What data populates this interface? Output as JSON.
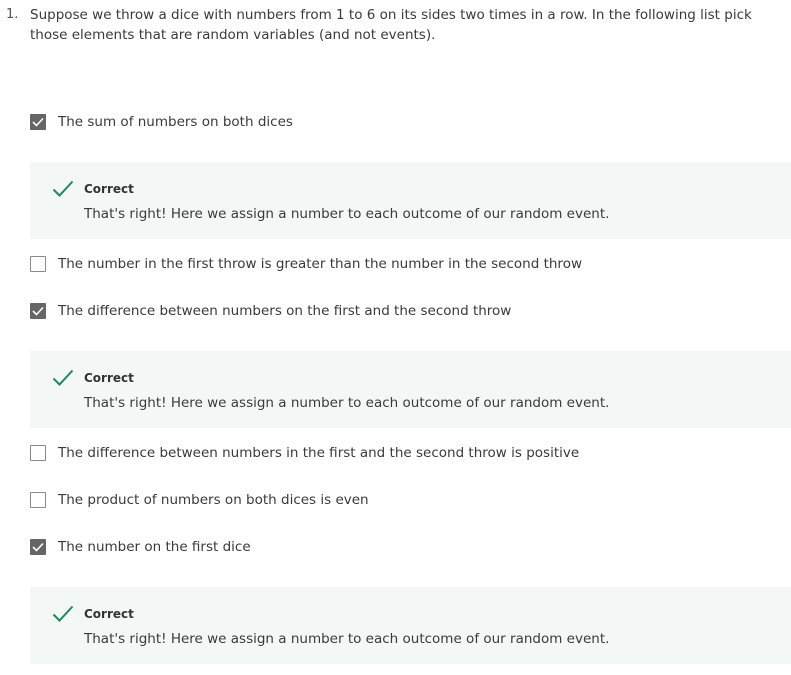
{
  "question": {
    "number": "1.",
    "text": "Suppose we throw a dice with numbers from 1 to 6 on its sides two times in a row. In the following list pick those elements that are random variables (and not events)."
  },
  "options": [
    {
      "label": "The sum of numbers on both dices",
      "checked": true
    },
    {
      "label": "The number in the first throw is greater than the number in the second throw",
      "checked": false
    },
    {
      "label": "The difference between numbers on the first and the second throw",
      "checked": true
    },
    {
      "label": "The difference between numbers in the first and the second throw is positive",
      "checked": false
    },
    {
      "label": "The product of numbers on both dices is even",
      "checked": false
    },
    {
      "label": "The number on the first dice",
      "checked": true
    }
  ],
  "feedback": [
    {
      "title": "Correct",
      "text": "That's right! Here we assign a number to each outcome of our random event."
    },
    {
      "title": "Correct",
      "text": "That's right! Here we assign a number to each outcome of our random event."
    },
    {
      "title": "Correct",
      "text": "That's right! Here we assign a number to each outcome of our random event."
    }
  ],
  "colors": {
    "correct_green": "#1e8a57",
    "feedback_bg": "#f3f8f6",
    "checked_box": "#666666"
  },
  "icons": {
    "checked": "check-icon",
    "correct": "correct-check-icon"
  }
}
